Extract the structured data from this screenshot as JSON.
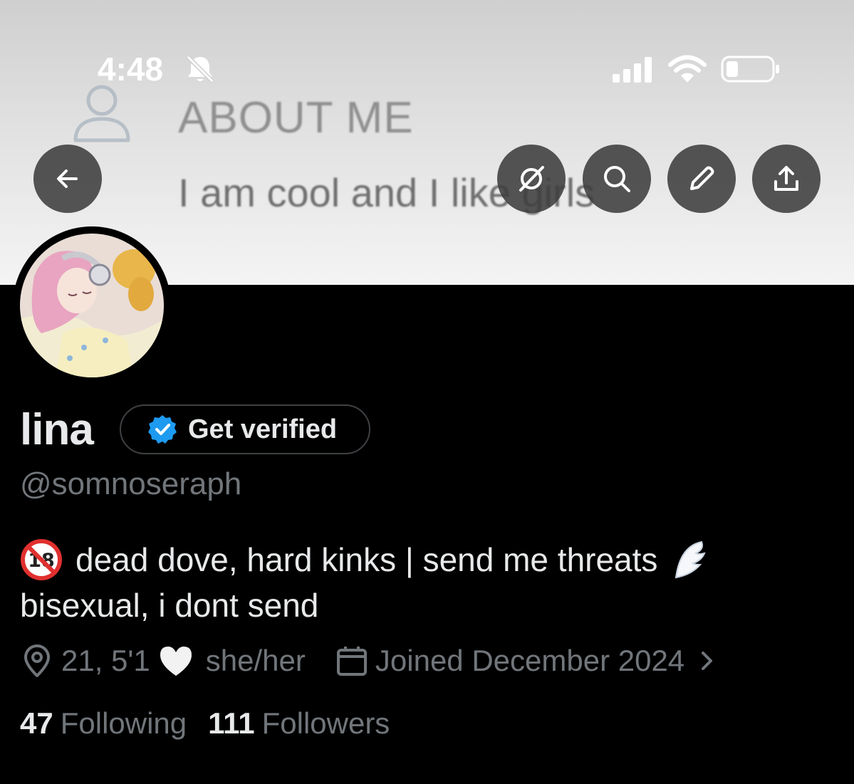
{
  "status_bar": {
    "time": "4:48",
    "icons": [
      "bell-slash-icon",
      "cellular-signal-icon",
      "wifi-icon",
      "battery-icon"
    ]
  },
  "banner": {
    "heading": "ABOUT ME",
    "text": "I am cool and I like girls"
  },
  "top_buttons": [
    "back-arrow-icon",
    "grok-icon",
    "search-icon",
    "edit-pencil-icon",
    "share-icon"
  ],
  "profile": {
    "display_name": "lina",
    "verify_label": "Get verified",
    "handle": "@somnoseraph",
    "bio_line1": "dead dove, hard kinks | send me threats",
    "bio_line2": "bisexual, i dont send",
    "location": "21, 5'1",
    "pronouns": "she/her",
    "joined": "Joined December 2024",
    "following_count": "47",
    "following_label": "Following",
    "followers_count": "111",
    "followers_label": "Followers"
  },
  "colors": {
    "background": "#000000",
    "primary_text": "#e7e9ea",
    "secondary_text": "#71767b",
    "verified_blue": "#1d9bf0"
  }
}
